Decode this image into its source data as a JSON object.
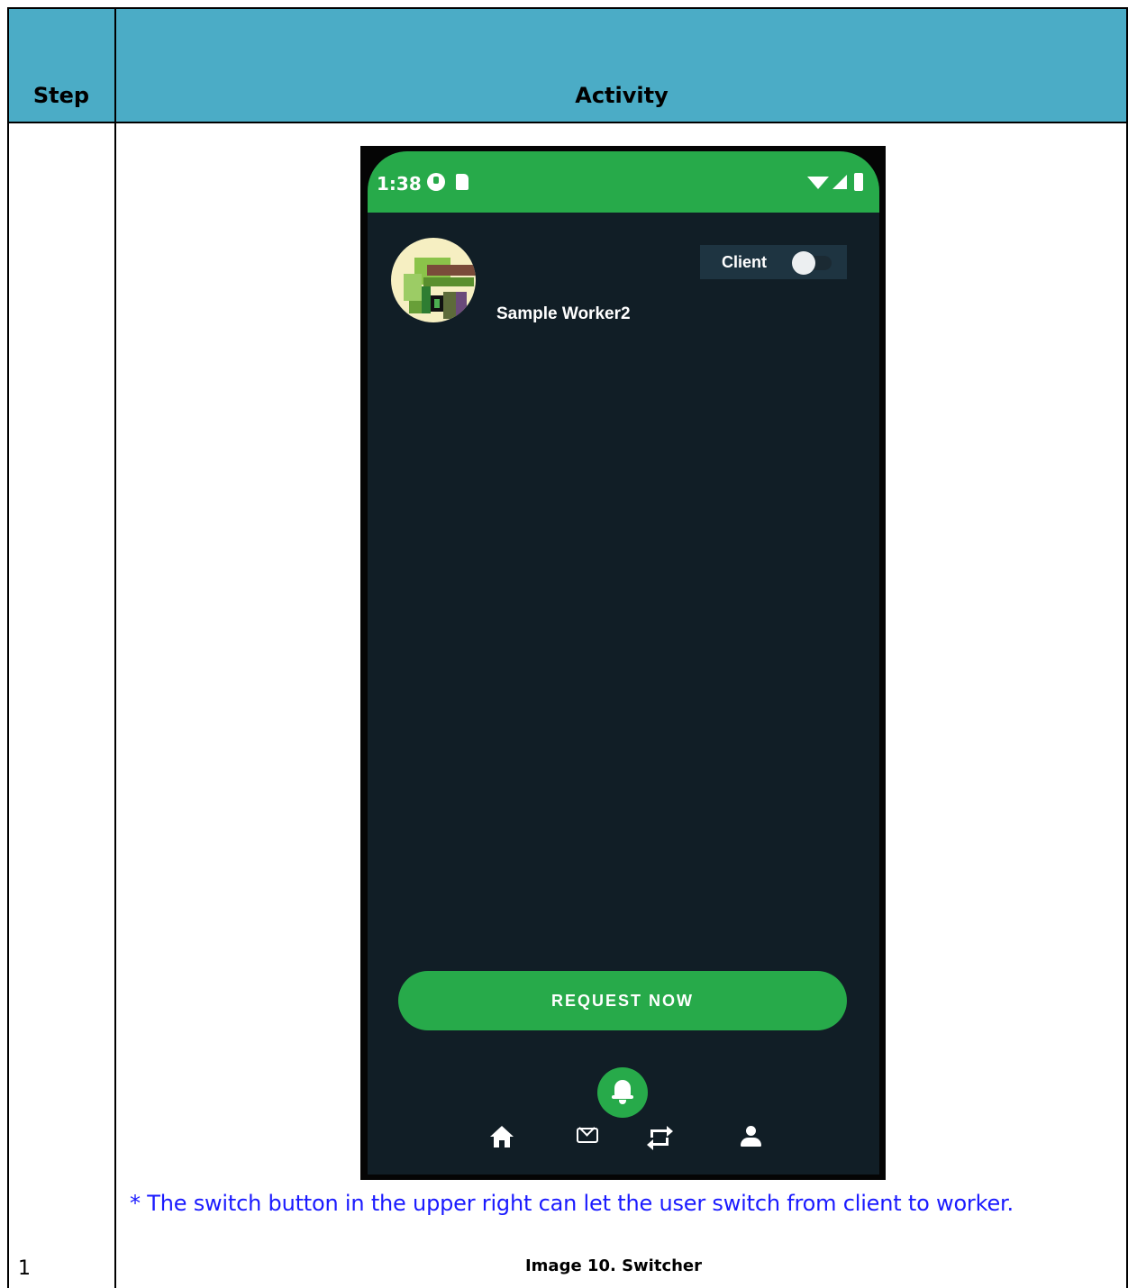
{
  "table": {
    "headers": {
      "step": "Step",
      "activity": "Activity"
    },
    "step_number": "1",
    "header_color": "#4bacc6"
  },
  "phone": {
    "status_bar": {
      "time": "1:38",
      "icons_left": [
        "data-saver-icon",
        "sd-card-icon"
      ],
      "icons_right": [
        "wifi-icon",
        "signal-icon",
        "battery-icon"
      ],
      "color": "#27aa4a"
    },
    "background_color": "#111e26",
    "profile": {
      "name": "Sample Worker2",
      "avatar": "pixel-avatar"
    },
    "switcher": {
      "label": "Client",
      "state": "off"
    },
    "request_button": {
      "label": "REQUEST NOW",
      "color": "#27aa4a"
    },
    "fab_icon": "bell-icon",
    "bottom_nav": [
      "home-icon",
      "mail-icon",
      "swap-icon",
      "person-icon"
    ]
  },
  "note": "* The switch button in the upper right can let the user switch from client to worker.",
  "note_color": "#1a1aff",
  "caption": "Image 10.  Switcher"
}
